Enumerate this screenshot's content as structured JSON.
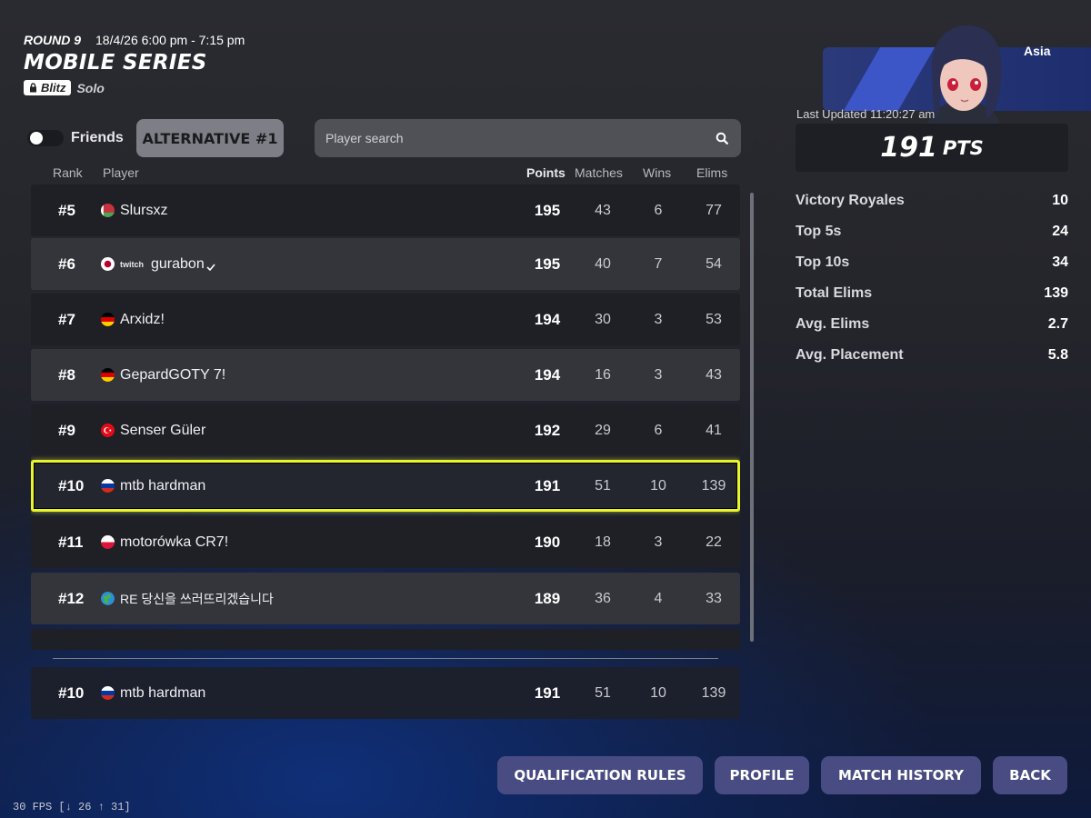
{
  "header": {
    "round": "ROUND 9",
    "datetime": "18/4/26 6:00 pm - 7:15 pm",
    "title": "MOBILE SERIES",
    "mode_badge": "Blitz",
    "mode_type": "Solo"
  },
  "controls": {
    "friends_label": "Friends",
    "friends_toggle_on": false,
    "alternative_label": "ALTERNATIVE #1",
    "search_placeholder": "Player search"
  },
  "columns": {
    "rank": "Rank",
    "player": "Player",
    "points": "Points",
    "matches": "Matches",
    "wins": "Wins",
    "elims": "Elims"
  },
  "rows": [
    {
      "rank": "#5",
      "player": "Slursxz",
      "flag": "belarus",
      "points": "195",
      "matches": "43",
      "wins": "6",
      "elims": "77"
    },
    {
      "rank": "#6",
      "player": "gurabon",
      "twitch": "twitch",
      "flag": "japan",
      "points": "195",
      "matches": "40",
      "wins": "7",
      "elims": "54"
    },
    {
      "rank": "#7",
      "player": "Arxidz!",
      "flag": "germany",
      "points": "194",
      "matches": "30",
      "wins": "3",
      "elims": "53"
    },
    {
      "rank": "#8",
      "player": "GepardGOTY 7!",
      "flag": "germany",
      "points": "194",
      "matches": "16",
      "wins": "3",
      "elims": "43"
    },
    {
      "rank": "#9",
      "player": "Senser Güler",
      "flag": "turkey",
      "points": "192",
      "matches": "29",
      "wins": "6",
      "elims": "41"
    },
    {
      "rank": "#10",
      "player": "mtb hardman",
      "flag": "russia",
      "points": "191",
      "matches": "51",
      "wins": "10",
      "elims": "139"
    },
    {
      "rank": "#11",
      "player": "motorówka CR7!",
      "flag": "poland",
      "points": "190",
      "matches": "18",
      "wins": "3",
      "elims": "22"
    },
    {
      "rank": "#12",
      "player": "RE 당신을 쓰러뜨리겠습니다",
      "flag": "globe",
      "points": "189",
      "matches": "36",
      "wins": "4",
      "elims": "33"
    }
  ],
  "self_row": {
    "rank": "#10",
    "player": "mtb hardman",
    "flag": "russia",
    "points": "191",
    "matches": "51",
    "wins": "10",
    "elims": "139"
  },
  "profile": {
    "region": "Asia",
    "last_updated": "Last Updated 11:20:27 am",
    "points_value": "191",
    "points_unit": "PTS",
    "stats": [
      {
        "label": "Victory Royales",
        "value": "10"
      },
      {
        "label": "Top 5s",
        "value": "24"
      },
      {
        "label": "Top 10s",
        "value": "34"
      },
      {
        "label": "Total Elims",
        "value": "139"
      },
      {
        "label": "Avg. Elims",
        "value": "2.7"
      },
      {
        "label": "Avg. Placement",
        "value": "5.8"
      }
    ]
  },
  "footer": {
    "qualification_rules": "QUALIFICATION RULES",
    "profile": "PROFILE",
    "match_history": "MATCH HISTORY",
    "back": "BACK"
  },
  "fps": "30 FPS [↓ 26 ↑ 31]",
  "colors": {
    "selection": "#e8f42c",
    "button": "#484c82",
    "accent_blue": "#2b3a7a"
  }
}
